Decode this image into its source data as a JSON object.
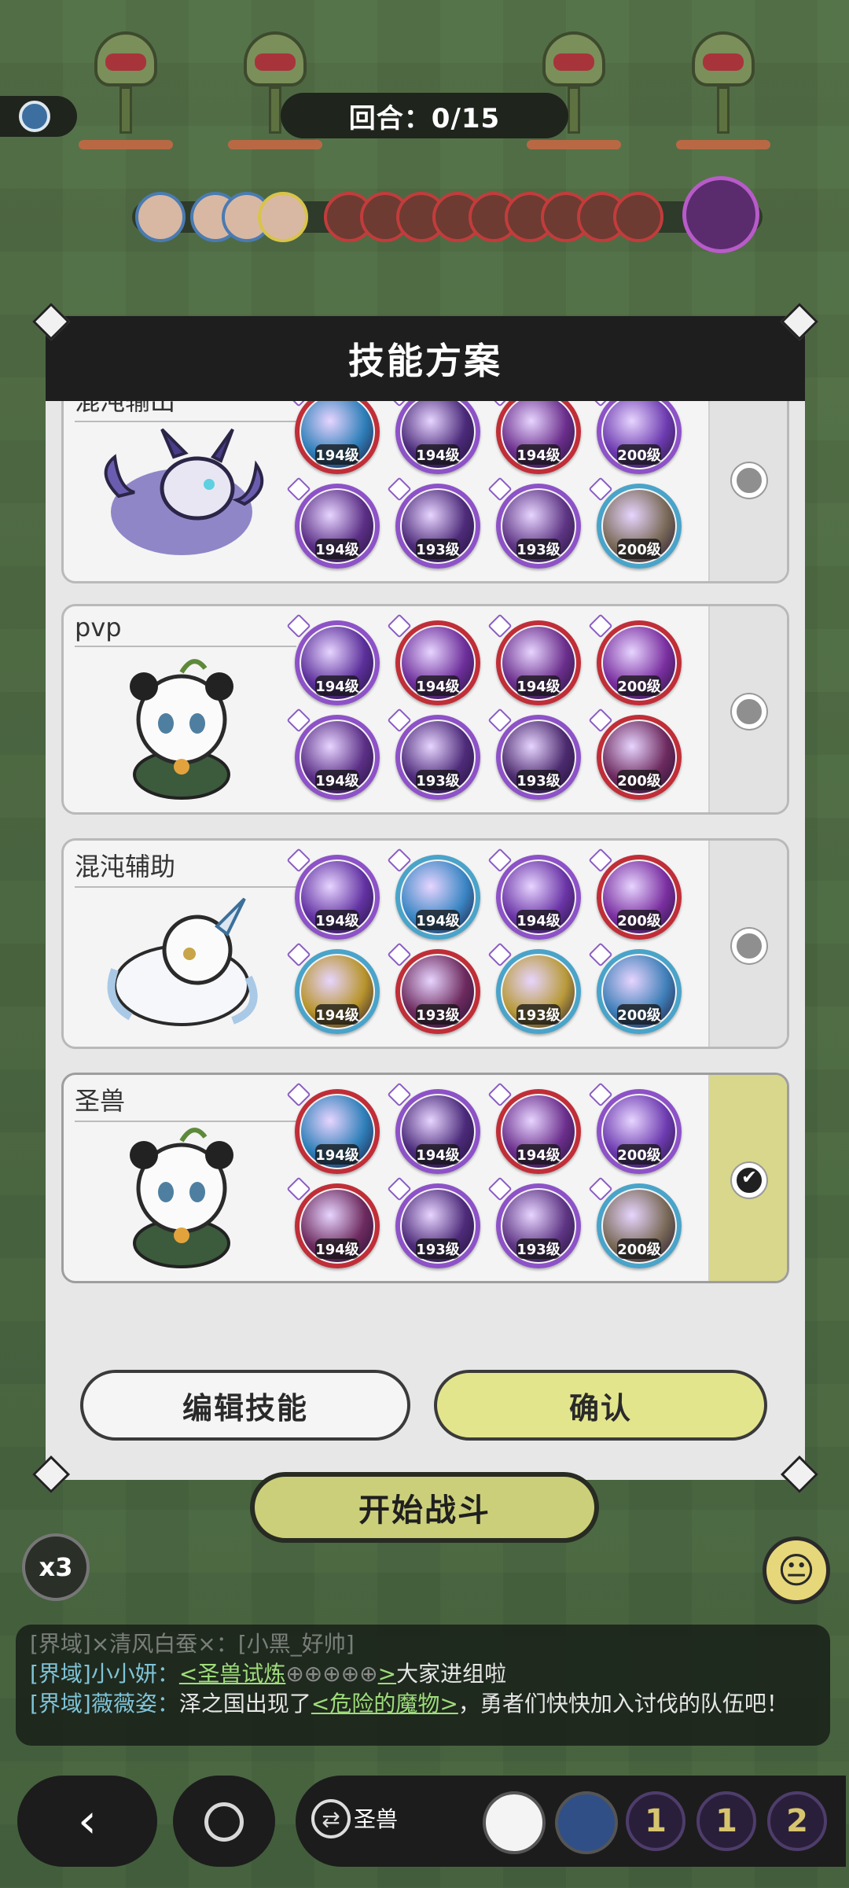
{
  "battle": {
    "round_label": "回合：0/15",
    "start_button": "开始战斗",
    "speed_label": "x3",
    "emoji_icon": "neutral-face-icon"
  },
  "modal": {
    "title": "技能方案",
    "edit_button": "编辑技能",
    "confirm_button": "确认",
    "plans": [
      {
        "name": "混沌输出",
        "selected": false,
        "skills": [
          {
            "level": "194级",
            "ring": "r",
            "core": "#2f7fb9"
          },
          {
            "level": "194级",
            "ring": "p",
            "core": "#4b2a7a"
          },
          {
            "level": "194级",
            "ring": "r",
            "core": "#6b2e8c"
          },
          {
            "level": "200级",
            "ring": "p",
            "core": "#6d3bb0"
          },
          {
            "level": "194级",
            "ring": "p",
            "core": "#5b2f86"
          },
          {
            "level": "193级",
            "ring": "p",
            "core": "#4e2b7a"
          },
          {
            "level": "193级",
            "ring": "p",
            "core": "#5e3584"
          },
          {
            "level": "200级",
            "ring": "b",
            "core": "#7a6a58"
          }
        ]
      },
      {
        "name": "pvp",
        "selected": false,
        "skills": [
          {
            "level": "194级",
            "ring": "p",
            "core": "#5b2f9a"
          },
          {
            "level": "194级",
            "ring": "r",
            "core": "#6e2f9b"
          },
          {
            "level": "194级",
            "ring": "r",
            "core": "#6b2e8c"
          },
          {
            "level": "200级",
            "ring": "r",
            "core": "#7a2fa0"
          },
          {
            "level": "194级",
            "ring": "p",
            "core": "#5b2f86"
          },
          {
            "level": "193级",
            "ring": "p",
            "core": "#4e2b7a"
          },
          {
            "level": "193级",
            "ring": "p",
            "core": "#4c2a6e"
          },
          {
            "level": "200级",
            "ring": "r",
            "core": "#6d2a5e"
          }
        ]
      },
      {
        "name": "混沌辅助",
        "selected": false,
        "skills": [
          {
            "level": "194级",
            "ring": "p",
            "core": "#6232a2"
          },
          {
            "level": "194级",
            "ring": "b",
            "core": "#3a86c4"
          },
          {
            "level": "194级",
            "ring": "p",
            "core": "#6a34a6"
          },
          {
            "level": "200级",
            "ring": "r",
            "core": "#7a2fa0"
          },
          {
            "level": "194级",
            "ring": "b",
            "core": "#b8942c"
          },
          {
            "level": "193级",
            "ring": "r",
            "core": "#6d2a5e"
          },
          {
            "level": "193级",
            "ring": "b",
            "core": "#b89a3a"
          },
          {
            "level": "200级",
            "ring": "b",
            "core": "#3f7fb8"
          }
        ]
      },
      {
        "name": "圣兽",
        "selected": true,
        "skills": [
          {
            "level": "194级",
            "ring": "r",
            "core": "#2f7fb9"
          },
          {
            "level": "194级",
            "ring": "p",
            "core": "#4b2a7a"
          },
          {
            "level": "194级",
            "ring": "r",
            "core": "#6b2e8c"
          },
          {
            "level": "200级",
            "ring": "p",
            "core": "#6d3bb0"
          },
          {
            "level": "194级",
            "ring": "r",
            "core": "#6d2a5e"
          },
          {
            "level": "193级",
            "ring": "p",
            "core": "#4e2b7a"
          },
          {
            "level": "193级",
            "ring": "p",
            "core": "#5e3584"
          },
          {
            "level": "200级",
            "ring": "b",
            "core": "#7a6a58"
          }
        ]
      }
    ]
  },
  "chat": {
    "line0": "[界域]×清风白蚕×：[小黑_好帅]",
    "line1_tag": "[界域]小小妍：",
    "line1_link": "<圣兽试炼",
    "line1_icons": "⊕⊕⊕⊕⊕",
    "line1_close": ">",
    "line1_text": "大家进组啦",
    "line2_tag": "[界域]薇薇姿：",
    "line2_text_a": "泽之国出现了",
    "line2_link": "<危险的魔物>",
    "line2_text_b": "，勇者们快快加入讨伐的队伍吧！"
  },
  "bottom": {
    "back_icon": "chevron-left-icon",
    "team_name": "圣兽",
    "counts": [
      "1",
      "1",
      "2"
    ]
  },
  "colors": {
    "accent_yellow": "#e2e58c",
    "header_dark": "#1e1e1e",
    "ring_red": "#c02e38",
    "ring_purple": "#8d52c7"
  }
}
